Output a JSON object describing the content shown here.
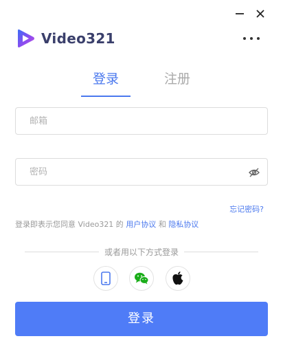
{
  "window": {
    "minimize_icon": "minimize-icon",
    "close_icon": "close-icon"
  },
  "brand": {
    "name": "Video321",
    "logo_icon": "play-logo-icon",
    "logo_colors": [
      "#3b6df6",
      "#8b4cf0",
      "#c14fe0"
    ]
  },
  "header": {
    "more_icon": "more-horizontal-icon"
  },
  "tabs": [
    {
      "label": "登录",
      "active": true
    },
    {
      "label": "注册",
      "active": false
    }
  ],
  "form": {
    "email": {
      "placeholder": "邮箱",
      "value": ""
    },
    "password": {
      "placeholder": "密码",
      "value": "",
      "toggle_icon": "eye-off-icon"
    },
    "forgot_label": "忘记密码?"
  },
  "agreement": {
    "prefix": "登录即表示您同意 Video321 的",
    "user_agreement": "用户协议",
    "and": "和",
    "privacy_policy": "隐私协议"
  },
  "alternate": {
    "label": "或者用以下方式登录",
    "options": [
      {
        "name": "phone",
        "icon": "phone-icon"
      },
      {
        "name": "wechat",
        "icon": "wechat-icon"
      },
      {
        "name": "apple",
        "icon": "apple-icon"
      }
    ]
  },
  "submit_label": "登录",
  "colors": {
    "accent": "#4a78ee",
    "button": "#4f7cf7",
    "wechat": "#1aad19"
  }
}
